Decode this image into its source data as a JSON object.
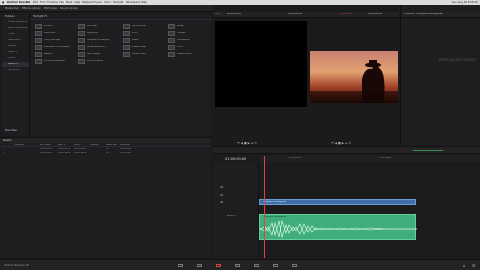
{
  "menubar": {
    "items": [
      "DaVinci Resolve",
      "File",
      "Edit",
      "Trim",
      "Timeline",
      "Clip",
      "Mark",
      "View",
      "Playback",
      "Fusion",
      "Color",
      "Fairlight",
      "Workspace",
      "Help"
    ],
    "clock": "Sun Aug 18  9:58 AM"
  },
  "toolbar": {
    "media_pool": "Media Pool",
    "effects_library": "Effects Library",
    "edit_index": "Edit Index",
    "sound_library": "Sound Library",
    "project_title": "Sound Mixer",
    "mixer": "Mixer",
    "metadata": "Metadata",
    "inspector": "Inspector"
  },
  "effects_tree": {
    "header": "Toolbox",
    "items": [
      "Video Transitions",
      "Audio Transitions",
      "Titles",
      "Generators",
      "Effects",
      "Open FX",
      "Filters",
      "Audio FX",
      "FairlightFX"
    ],
    "selected_index": 7,
    "favorites": "Favorites"
  },
  "effects_list": {
    "header": "Fairlight FX",
    "items": [
      "Chorus",
      "De-Esser",
      "De-Hummer",
      "Delay",
      "Distortion",
      "Dynamics",
      "Echo",
      "Flanger",
      "Foley Sampler",
      "Frequency Analyzer",
      "Meter",
      "Modulation",
      "Multiband Compressor",
      "Noise Reduction",
      "Phase Meter",
      "Pitch",
      "Reverb",
      "Soft Clipper",
      "Stereo Fixer",
      "Stereo Width",
      "Surround Analyzer",
      "Vocal Channel"
    ]
  },
  "viewer": {
    "zoom": "53%",
    "source_timecode": "00:00:00:00",
    "record_timecode": "00:00:00:00",
    "timeline_name": "Timeline 1",
    "empty_label": "Nothing to inspect",
    "tc_end": "01:00:00:00"
  },
  "inspector": {
    "title": "Timeline - Composite Settings.aaf",
    "empty_message": "Nothing to inspect"
  },
  "media_pool": {
    "header": "Master",
    "columns": [
      "Clip Name",
      "Reel Name",
      "Start TC",
      "End TC",
      "Duration",
      "Frame Rate",
      "Resolution"
    ],
    "rows": [
      [
        "1",
        "",
        "00:00:00:00",
        "00:00:38:18",
        "00:00:38:18",
        "24",
        "1920x1080"
      ],
      [
        "2",
        "",
        "00:00:00:00",
        "00:00:38:18",
        "00:00:38:18",
        "24",
        "1920x1080"
      ]
    ]
  },
  "timeline": {
    "timecode": "01:00:00:00",
    "ruler": [
      "01:00:00:00",
      "01:00:08:00",
      "01:00:16:00"
    ],
    "tracks": [
      {
        "name": "V2"
      },
      {
        "name": "V1"
      },
      {
        "name": "A1"
      }
    ],
    "video_clip": "Composite Settings.aaf",
    "audio_clip": "Composite Settings.aaf",
    "audio_track_name": "Audio 1"
  },
  "bottombar": {
    "app_name": "DaVinci Resolve 18",
    "pages": [
      "Media",
      "Cut",
      "Edit",
      "Fusion",
      "Color",
      "Fairlight",
      "Deliver"
    ],
    "active_page": 2
  },
  "colors": {
    "accent_red": "#e0423f",
    "video_clip": "#3e6fa7",
    "audio_clip": "#3fae7a"
  }
}
